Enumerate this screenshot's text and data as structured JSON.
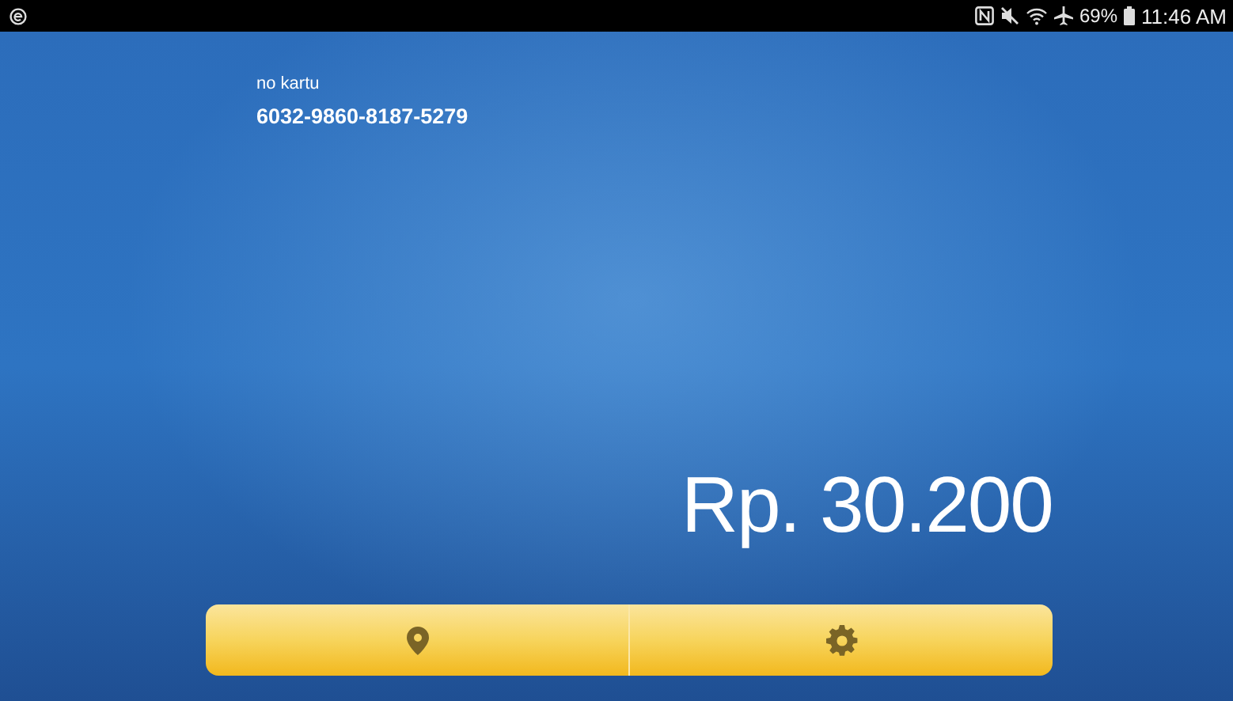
{
  "status_bar": {
    "battery": "69%",
    "time": "11:46 AM"
  },
  "card": {
    "label": "no kartu",
    "number": "6032-9860-8187-5279"
  },
  "balance": "Rp. 30.200",
  "toolbar": [
    {
      "kind": "location"
    },
    {
      "kind": "settings"
    }
  ]
}
